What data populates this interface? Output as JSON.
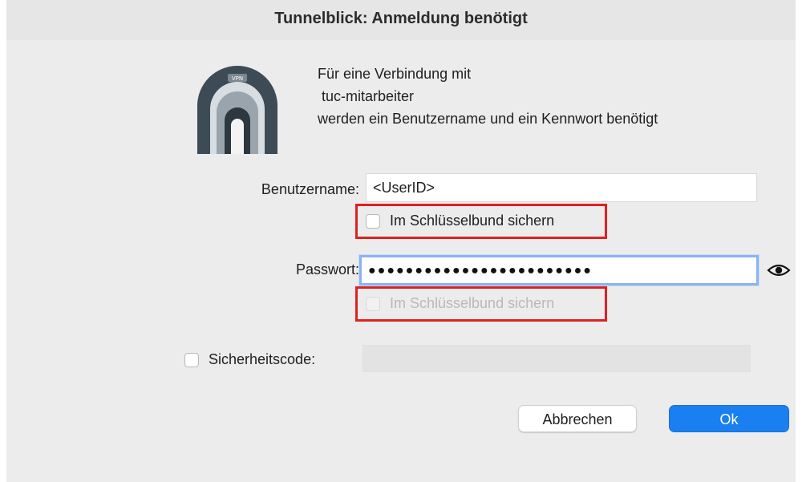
{
  "window": {
    "title": "Tunnelblick: Anmeldung benötigt"
  },
  "app_icon": {
    "icon": "tunnelblick-vpn-icon",
    "badge": "VPN"
  },
  "message": {
    "line1": "Für eine Verbindung mit",
    "line2": " tuc-mitarbeiter",
    "line3": "werden ein Benutzername und ein Kennwort benötigt"
  },
  "username": {
    "label": "Benutzername:",
    "value": "<UserID>",
    "save_checkbox": {
      "label": "Im Schlüsselbund sichern",
      "checked": false
    }
  },
  "password": {
    "label": "Passwort:",
    "masked_value": "●●●●●●●●●●●●●●●●●●●●●●●●",
    "save_checkbox": {
      "label": "Im Schlüsselbund sichern",
      "checked": false,
      "enabled": false
    },
    "reveal_icon": "eye-icon"
  },
  "security_code": {
    "label": "Sicherheitscode:",
    "checked": false,
    "value": ""
  },
  "buttons": {
    "cancel": "Abbrechen",
    "ok": "Ok"
  },
  "colors": {
    "accent": "#1a7ff0",
    "highlight": "#e02020",
    "focus_ring": "#8ab4f0"
  }
}
